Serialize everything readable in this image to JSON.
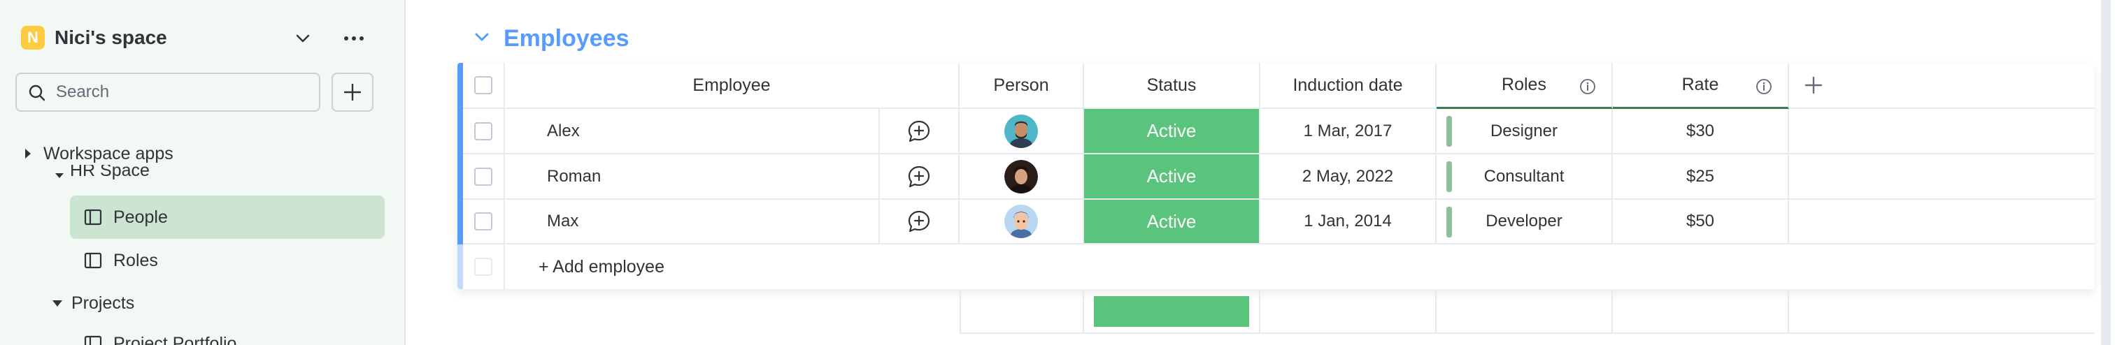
{
  "sidebar": {
    "workspace_badge": "N",
    "workspace_name": "Nici's space",
    "search_placeholder": "Search",
    "workspace_apps": "Workspace apps",
    "hr_space": "HR Space",
    "items": [
      {
        "label": "People",
        "selected": true
      },
      {
        "label": "Roles",
        "selected": false
      }
    ],
    "projects": "Projects",
    "project_portfolio": "Project Portfolio"
  },
  "group": {
    "title": "Employees",
    "color": "#579bfc"
  },
  "table": {
    "headers": {
      "employee": "Employee",
      "person": "Person",
      "status": "Status",
      "induction_date": "Induction date",
      "roles": "Roles",
      "rate": "Rate"
    },
    "rows": [
      {
        "name": "Alex",
        "status": "Active",
        "date": "1 Mar, 2017",
        "role": "Designer",
        "rate": "$30",
        "avatar": "avatar-alex"
      },
      {
        "name": "Roman",
        "status": "Active",
        "date": "2 May, 2022",
        "role": "Consultant",
        "rate": "$25",
        "avatar": "avatar-roman"
      },
      {
        "name": "Max",
        "status": "Active",
        "date": "1 Jan, 2014",
        "role": "Developer",
        "rate": "$50",
        "avatar": "avatar-max"
      }
    ],
    "add_row_label": "+ Add employee",
    "status_color": "#5ac47d"
  }
}
